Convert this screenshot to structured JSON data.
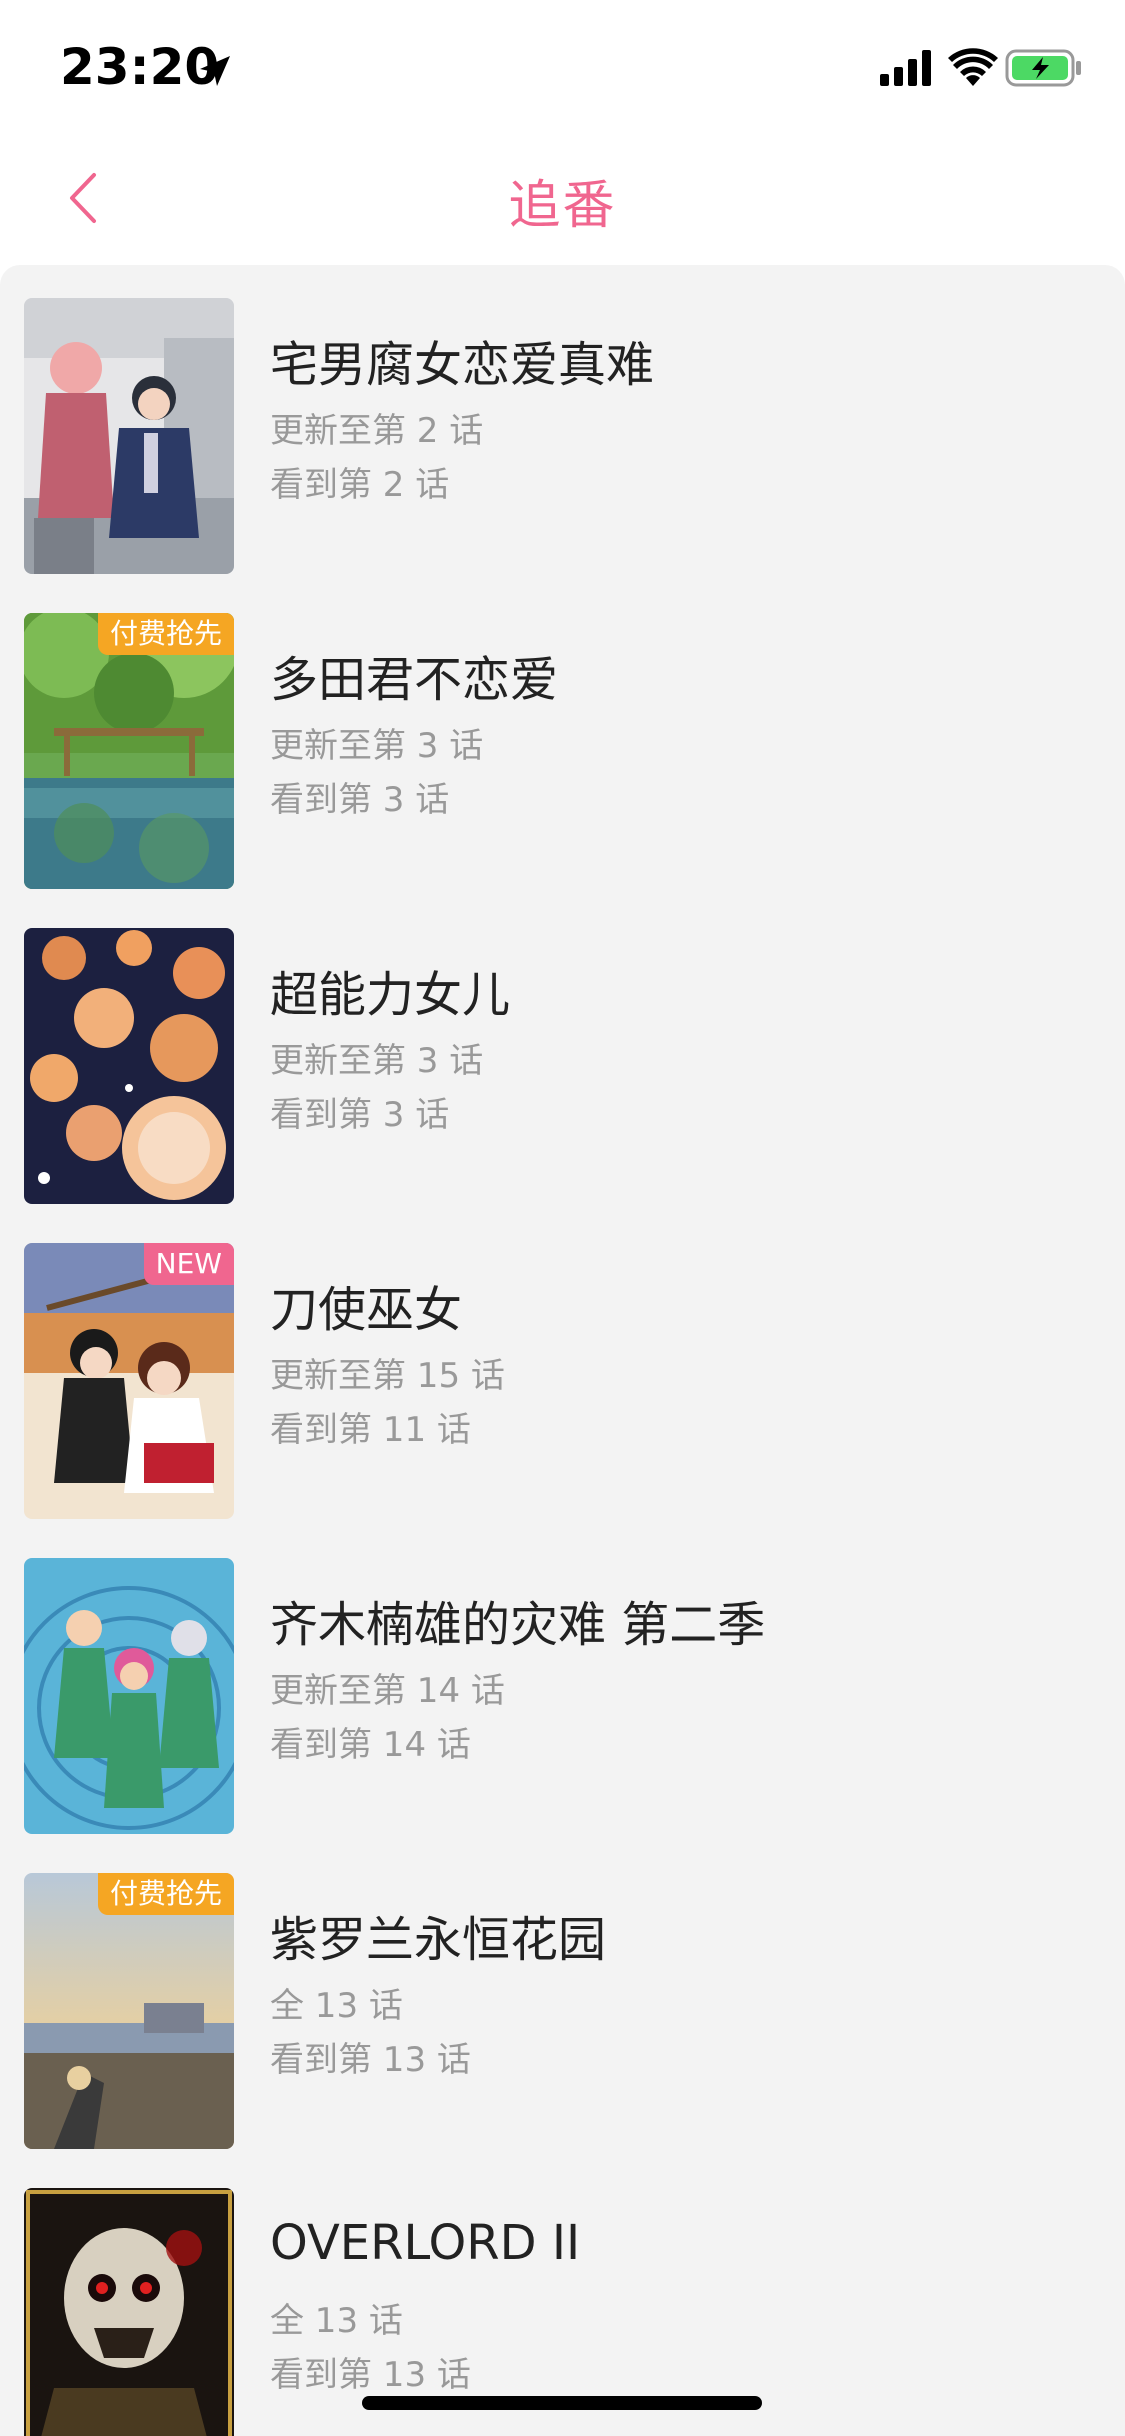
{
  "status": {
    "time": "23:20"
  },
  "nav": {
    "title": "追番"
  },
  "items": [
    {
      "title": "宅男腐女恋爱真难",
      "update": "更新至第 2 话",
      "watched": "看到第 2 话",
      "badge": ""
    },
    {
      "title": "多田君不恋爱",
      "update": "更新至第 3 话",
      "watched": "看到第 3 话",
      "badge": "付费抢先"
    },
    {
      "title": "超能力女儿",
      "update": "更新至第 3 话",
      "watched": "看到第 3 话",
      "badge": ""
    },
    {
      "title": "刀使巫女",
      "update": "更新至第 15 话",
      "watched": "看到第 11 话",
      "badge": "NEW"
    },
    {
      "title": "齐木楠雄的灾难 第二季",
      "update": "更新至第 14 话",
      "watched": "看到第 14 话",
      "badge": ""
    },
    {
      "title": "紫罗兰永恒花园",
      "update": "全 13 话",
      "watched": "看到第 13 话",
      "badge": "付费抢先"
    },
    {
      "title": "OVERLORD II",
      "update": "全 13 话",
      "watched": "看到第 13 话",
      "badge": ""
    }
  ],
  "colors": {
    "accent": "#f0668f",
    "pay_badge": "#f5a623",
    "new_badge": "#f0668f",
    "list_bg": "#f3f3f3"
  }
}
